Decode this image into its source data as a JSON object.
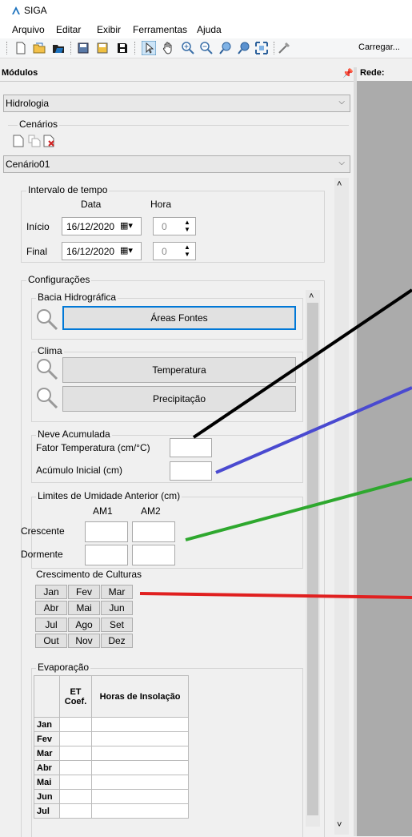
{
  "app": {
    "title": "SIGA"
  },
  "menu": [
    {
      "label": "Arquivo"
    },
    {
      "label": "Editar"
    },
    {
      "label": "Exibir"
    },
    {
      "label": "Ferramentas"
    },
    {
      "label": "Ajuda"
    }
  ],
  "toolbar": {
    "carregar_label": "Carregar..."
  },
  "modules_panel": {
    "header": "Módulos",
    "pin_icon": "pin-icon",
    "module_select": "Hidrologia",
    "cenarios_label": "Cenários",
    "cenario_select": "Cenário01"
  },
  "rede_panel": {
    "header": "Rede:"
  },
  "intervalo": {
    "label": "Intervalo de tempo",
    "col_data": "Data",
    "col_hora": "Hora",
    "inicio_label": "Início",
    "inicio_date": "16/12/2020",
    "inicio_hour": "0",
    "final_label": "Final",
    "final_date": "16/12/2020",
    "final_hour": "0"
  },
  "config": {
    "label": "Configurações",
    "bacia_label": "Bacia Hidrográfica",
    "areas_fontes_button": "Áreas Fontes",
    "clima_label": "Clima",
    "temperatura_button": "Temperatura",
    "precipitacao_button": "Precipitação",
    "neve_label": "Neve Acumulada",
    "fator_temp_label": "Fator Temperatura (cm/°C)",
    "acumulo_label": "Acúmulo Inicial (cm)",
    "umidade_label": "Limites de Umidade Anterior (cm)",
    "am1": "AM1",
    "am2": "AM2",
    "crescente_label": "Crescente",
    "dormente_label": "Dormente",
    "culturas_label": "Crescimento de Culturas",
    "months": [
      "Jan",
      "Fev",
      "Mar",
      "Abr",
      "Mai",
      "Jun",
      "Jul",
      "Ago",
      "Set",
      "Out",
      "Nov",
      "Dez"
    ],
    "evaporacao_label": "Evaporação",
    "evap_col_et": "ET Coef.",
    "evap_col_horas": "Horas de Insolação",
    "evap_rows": [
      "Jan",
      "Fev",
      "Mar",
      "Abr",
      "Mai",
      "Jun",
      "Jul"
    ]
  },
  "annotations": {
    "colors": [
      "#000000",
      "#4a4ad0",
      "#2ea82e",
      "#e02020"
    ]
  }
}
